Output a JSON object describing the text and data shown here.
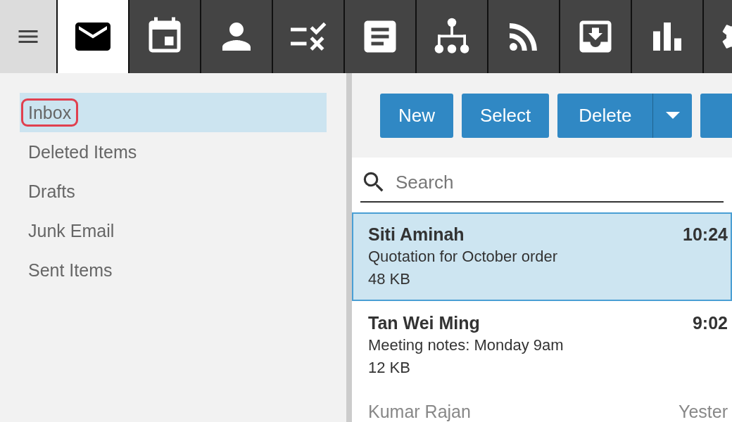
{
  "nav_tabs": [
    {
      "kind": "mail",
      "selected": true
    },
    {
      "kind": "calendar",
      "selected": false
    },
    {
      "kind": "contacts",
      "selected": false
    },
    {
      "kind": "tasks",
      "selected": false
    },
    {
      "kind": "notes",
      "selected": false
    },
    {
      "kind": "directory",
      "selected": false
    },
    {
      "kind": "feeds",
      "selected": false
    },
    {
      "kind": "archive",
      "selected": false
    },
    {
      "kind": "reports",
      "selected": false
    },
    {
      "kind": "settings",
      "selected": false
    }
  ],
  "folders": [
    {
      "label": "Inbox",
      "selected": true,
      "highlighted": true
    },
    {
      "label": "Deleted Items",
      "selected": false,
      "highlighted": false
    },
    {
      "label": "Drafts",
      "selected": false,
      "highlighted": false
    },
    {
      "label": "Junk Email",
      "selected": false,
      "highlighted": false
    },
    {
      "label": "Sent Items",
      "selected": false,
      "highlighted": false
    }
  ],
  "toolbar": {
    "buttons": [
      "New",
      "Select"
    ],
    "split_button": "Delete"
  },
  "search": {
    "placeholder": "Search"
  },
  "messages": [
    {
      "sender": "Siti Aminah",
      "time": "10:24",
      "subject": "Quotation for October order",
      "size": "48 KB",
      "unread": true,
      "selected": true
    },
    {
      "sender": "Tan Wei Ming",
      "time": "9:02",
      "subject": "Meeting notes: Monday 9am",
      "size": "12 KB",
      "unread": true,
      "selected": false
    },
    {
      "sender": "Kumar Rajan",
      "time": "Yester",
      "unread": false,
      "selected": false
    }
  ]
}
